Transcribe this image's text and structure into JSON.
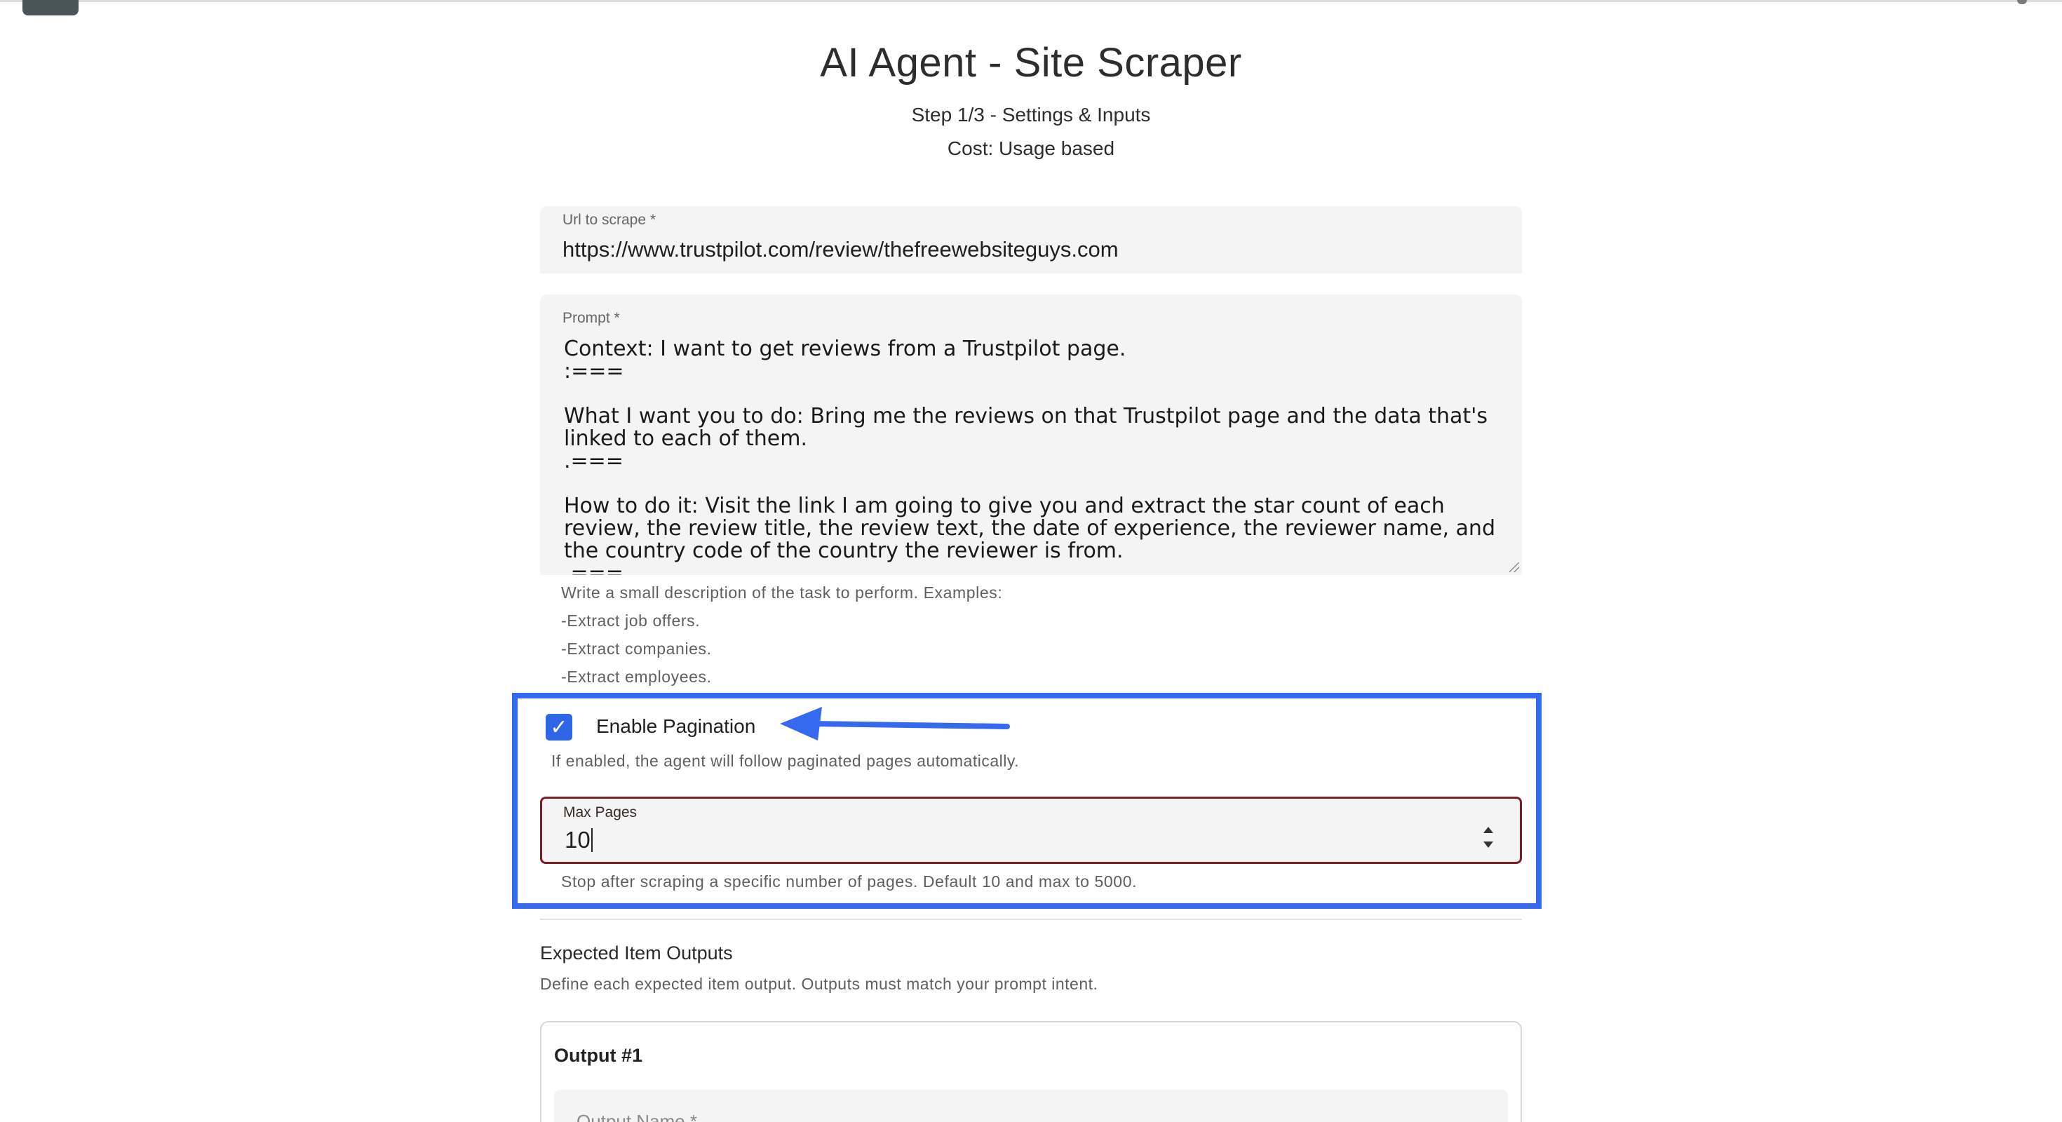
{
  "header": {
    "title": "AI Agent - Site Scraper",
    "step": "Step 1/3 - Settings & Inputs",
    "cost": "Cost: Usage based"
  },
  "url_field": {
    "label": "Url to scrape *",
    "value": "https://www.trustpilot.com/review/thefreewebsiteguys.com"
  },
  "prompt_field": {
    "label": "Prompt *",
    "value": "Context: I want to get reviews from a Trustpilot page.\n:===\n\nWhat I want you to do: Bring me the reviews on that Trustpilot page and the data that's linked to each of them.\n.===\n\nHow to do it: Visit the link I am going to give you and extract the star count of each review, the review title, the review text, the date of experience, the reviewer name, and the country code of the country the reviewer is from.\n.===",
    "helper_lines": [
      "Write a small description of the task to perform. Examples:",
      "-Extract job offers.",
      "-Extract companies.",
      "-Extract employees."
    ]
  },
  "pagination": {
    "checkbox_label": "Enable Pagination",
    "checked": true,
    "helper": "If enabled, the agent will follow paginated pages automatically.",
    "max_pages_label": "Max Pages",
    "max_pages_value": "10",
    "max_pages_helper": "Stop after scraping a specific number of pages. Default 10 and max to 5000."
  },
  "outputs": {
    "title": "Expected Item Outputs",
    "subtitle": "Define each expected item output. Outputs must match your prompt intent.",
    "cards": [
      {
        "title": "Output #1",
        "name_label": "Output Name *"
      }
    ]
  },
  "colors": {
    "highlight": "#3569f0",
    "checkbox": "#2e66e8",
    "field_bg": "#f3f4f3",
    "focused_border": "#7b1f26"
  },
  "icons": {
    "checkbox": "check-icon",
    "annotation": "arrow-left-icon",
    "stepper": "spin-arrows-icon"
  }
}
